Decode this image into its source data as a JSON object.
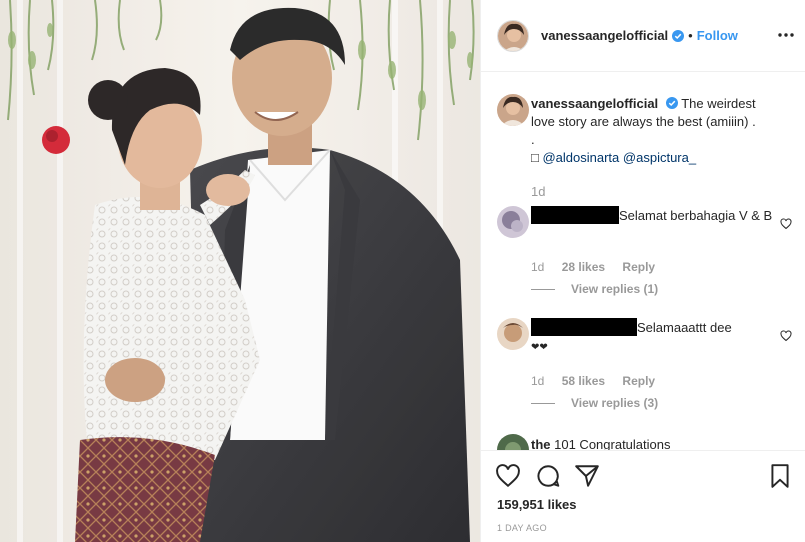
{
  "post": {
    "username": "vanessaangelofficial",
    "follow_label": "Follow",
    "separator": "•"
  },
  "caption": {
    "username": "vanessaangelofficial",
    "text": "The weirdest love story are always the best (amiiin) .",
    "line2": ".",
    "glyph": "□",
    "mention1": "@aldosinarta",
    "mention2": "@aspictura_",
    "time": "1d"
  },
  "comments": [
    {
      "text": "Selamat berbahagia V & B",
      "time": "1d",
      "likes": "28 likes",
      "reply_label": "Reply",
      "view_replies": "View replies (1)"
    },
    {
      "text": "Selamaaattt dee",
      "emoji": "❤❤",
      "time": "1d",
      "likes": "58 likes",
      "reply_label": "Reply",
      "view_replies": "View replies (3)"
    },
    {
      "username": "the",
      "text": "101 Congratulations"
    }
  ],
  "footer": {
    "likes": "159,951 likes",
    "time_ago": "1 DAY AGO"
  },
  "icons": {
    "verified": "verified-badge-icon",
    "more": "more-options-icon",
    "heart": "heart-icon",
    "comment": "comment-icon",
    "share": "share-icon",
    "save": "bookmark-icon"
  },
  "colors": {
    "link_blue": "#3897f0",
    "mention": "#003569",
    "muted": "#999999",
    "text": "#262626"
  }
}
